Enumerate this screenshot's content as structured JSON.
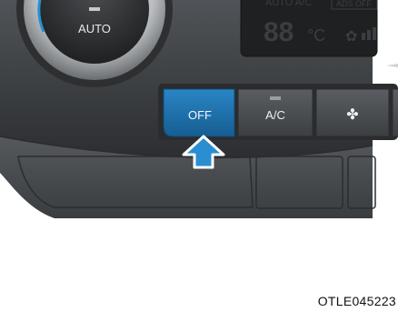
{
  "knob": {
    "label": "AUTO"
  },
  "display": {
    "top_text": "AUTO A/C",
    "temperature": "88",
    "unit": "°C",
    "badge": "ADS OFF"
  },
  "buttons": [
    {
      "label": "OFF",
      "active": true
    },
    {
      "label": "A/C",
      "active": false
    },
    {
      "label": "",
      "icon": "fan-icon",
      "active": false
    }
  ],
  "pointer": {
    "icon": "up-arrow-icon",
    "color": "#2b8ed0"
  },
  "caption": "OTLE045223",
  "colors": {
    "panel": "#3a3c3f",
    "button_active": "#1f6fa8",
    "button": "#4a4d51",
    "display": "#1e2022"
  }
}
